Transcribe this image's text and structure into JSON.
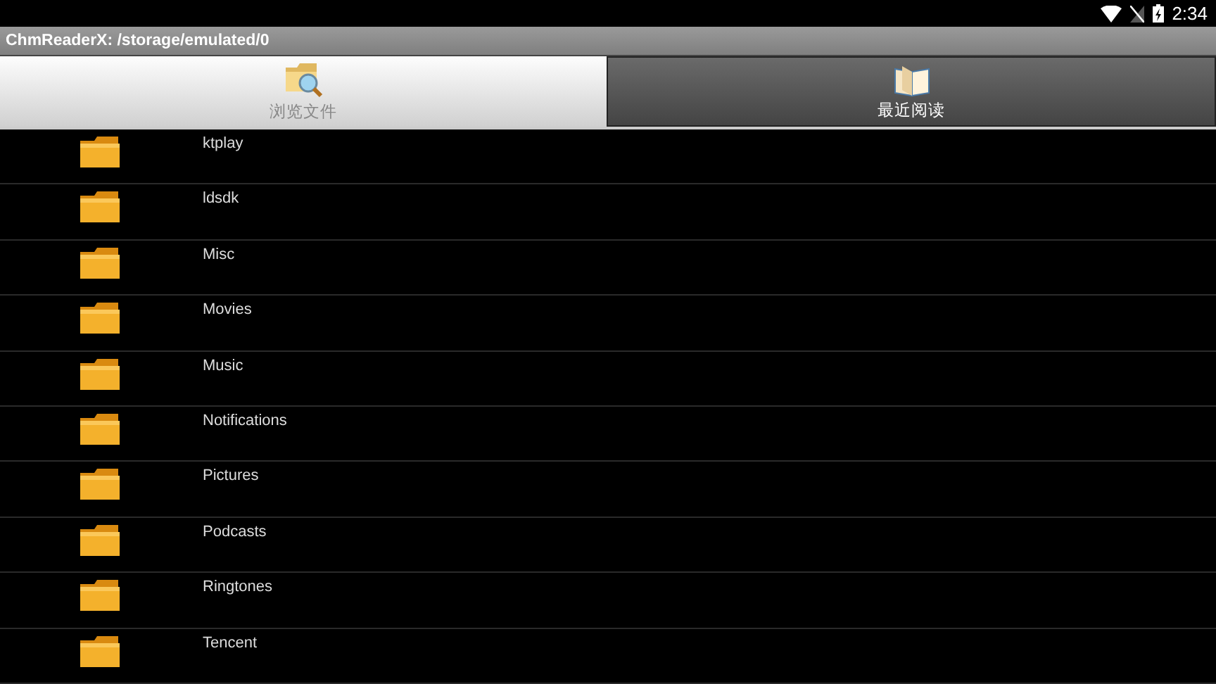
{
  "status_bar": {
    "time": "2:34"
  },
  "title_bar": {
    "title": "ChmReaderX: /storage/emulated/0"
  },
  "tabs": [
    {
      "label": "浏览文件",
      "selected": true,
      "kind": "browse"
    },
    {
      "label": "最近阅读",
      "selected": false,
      "kind": "recent"
    }
  ],
  "files": [
    {
      "name": "ktplay"
    },
    {
      "name": "ldsdk"
    },
    {
      "name": "Misc"
    },
    {
      "name": "Movies"
    },
    {
      "name": "Music"
    },
    {
      "name": "Notifications"
    },
    {
      "name": "Pictures"
    },
    {
      "name": "Podcasts"
    },
    {
      "name": "Ringtones"
    },
    {
      "name": "Tencent"
    }
  ]
}
